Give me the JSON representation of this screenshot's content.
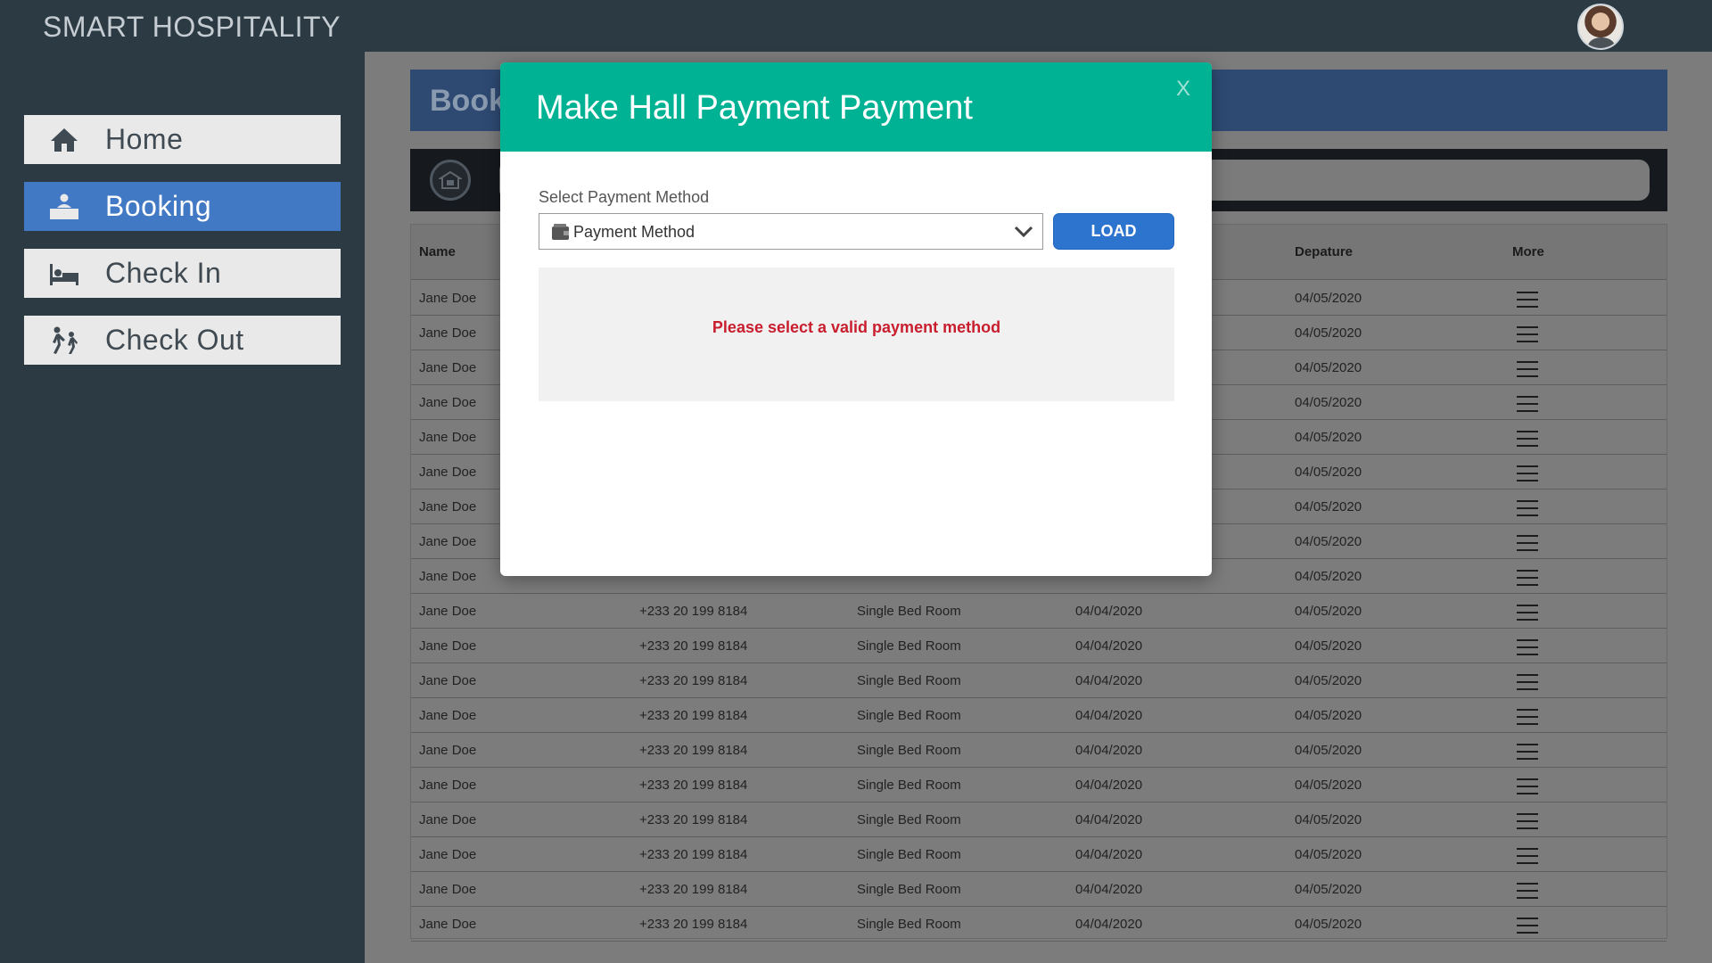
{
  "app": {
    "title": "SMART HOSPITALITY"
  },
  "sidebar": {
    "items": [
      {
        "label": "Home",
        "icon": "home-icon",
        "active": false
      },
      {
        "label": "Booking",
        "icon": "booking-desk-icon",
        "active": true
      },
      {
        "label": "Check In",
        "icon": "bed-icon",
        "active": false
      },
      {
        "label": "Check Out",
        "icon": "walking-people-icon",
        "active": false
      }
    ]
  },
  "main": {
    "header_title": "Book",
    "table": {
      "columns": [
        "Name",
        "",
        "",
        "",
        "Depature",
        "More"
      ],
      "rows": [
        [
          "Jane Doe",
          "",
          "",
          "",
          "04/05/2020"
        ],
        [
          "Jane Doe",
          "",
          "",
          "",
          "04/05/2020"
        ],
        [
          "Jane Doe",
          "",
          "",
          "",
          "04/05/2020"
        ],
        [
          "Jane Doe",
          "",
          "",
          "",
          "04/05/2020"
        ],
        [
          "Jane Doe",
          "",
          "",
          "",
          "04/05/2020"
        ],
        [
          "Jane Doe",
          "",
          "",
          "",
          "04/05/2020"
        ],
        [
          "Jane Doe",
          "",
          "",
          "",
          "04/05/2020"
        ],
        [
          "Jane Doe",
          "",
          "",
          "",
          "04/05/2020"
        ],
        [
          "Jane Doe",
          "",
          "",
          "",
          "04/05/2020"
        ],
        [
          "Jane Doe",
          "+233 20 199 8184",
          "Single Bed Room",
          "04/04/2020",
          "04/05/2020"
        ],
        [
          "Jane Doe",
          "+233 20 199 8184",
          "Single Bed Room",
          "04/04/2020",
          "04/05/2020"
        ],
        [
          "Jane Doe",
          "+233 20 199 8184",
          "Single Bed Room",
          "04/04/2020",
          "04/05/2020"
        ],
        [
          "Jane Doe",
          "+233 20 199 8184",
          "Single Bed Room",
          "04/04/2020",
          "04/05/2020"
        ],
        [
          "Jane Doe",
          "+233 20 199 8184",
          "Single Bed Room",
          "04/04/2020",
          "04/05/2020"
        ],
        [
          "Jane Doe",
          "+233 20 199 8184",
          "Single Bed Room",
          "04/04/2020",
          "04/05/2020"
        ],
        [
          "Jane Doe",
          "+233 20 199 8184",
          "Single Bed Room",
          "04/04/2020",
          "04/05/2020"
        ],
        [
          "Jane Doe",
          "+233 20 199 8184",
          "Single Bed Room",
          "04/04/2020",
          "04/05/2020"
        ],
        [
          "Jane Doe",
          "+233 20 199 8184",
          "Single Bed Room",
          "04/04/2020",
          "04/05/2020"
        ],
        [
          "Jane Doe",
          "+233 20 199 8184",
          "Single Bed Room",
          "04/04/2020",
          "04/05/2020"
        ]
      ]
    }
  },
  "modal": {
    "title": "Make Hall Payment Payment",
    "close_label": "X",
    "payment_method_label": "Select Payment Method",
    "payment_method_value": "Payment Method",
    "load_label": "LOAD",
    "message": "Please select a valid payment method"
  },
  "colors": {
    "sidebar_bg": "#2c3a44",
    "nav_active": "#4279c4",
    "modal_header": "#00b294",
    "load_button": "#2d74cf",
    "error_text": "#c81e2e"
  }
}
